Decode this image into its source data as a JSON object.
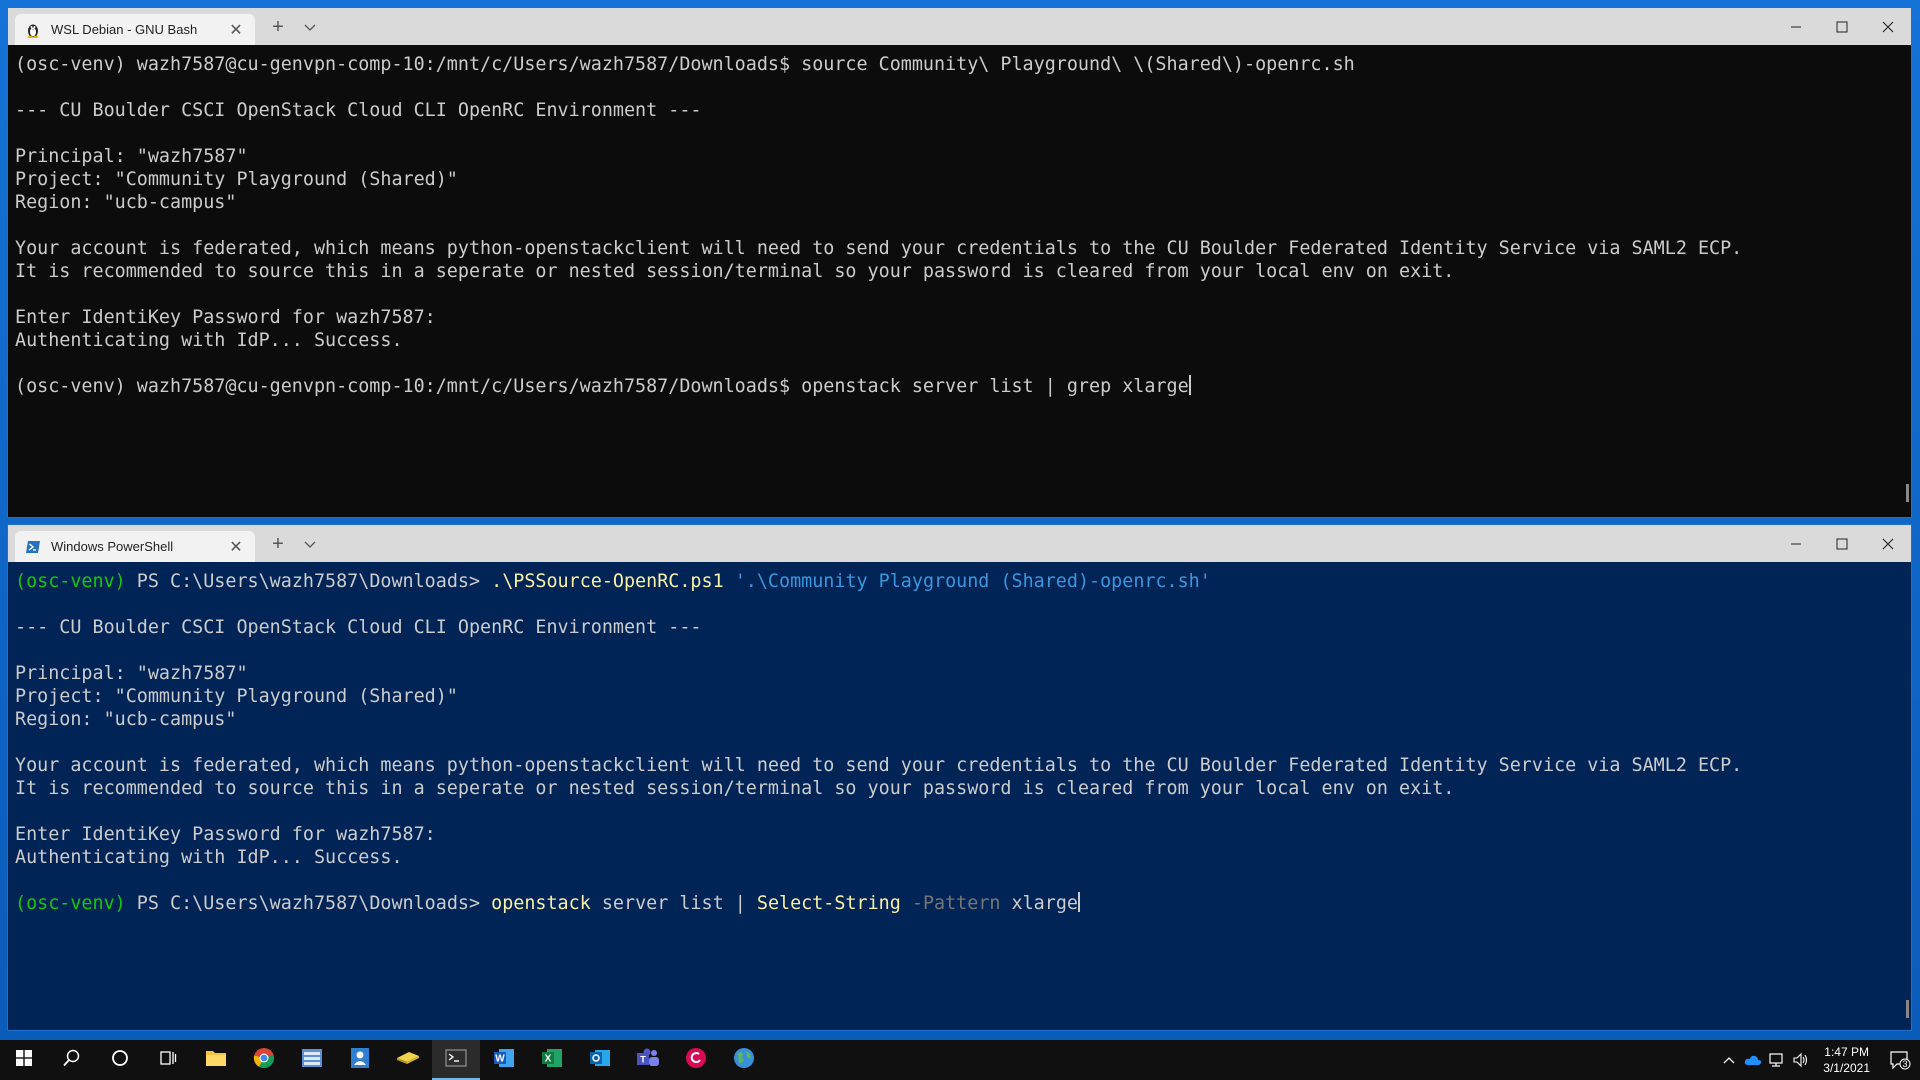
{
  "windows": [
    {
      "tab_title": "WSL Debian - GNU Bash",
      "tab_icon": "linux-penguin-icon",
      "lines": [
        [
          {
            "t": "(osc-venv) wazh7587@cu-genvpn-comp-10:/mnt/c/Users/wazh7587/Downloads$ source Community\\ Playground\\ \\(Shared\\)-openrc.sh"
          }
        ],
        [
          {
            "t": ""
          }
        ],
        [
          {
            "t": "--- CU Boulder CSCI OpenStack Cloud CLI OpenRC Environment ---"
          }
        ],
        [
          {
            "t": ""
          }
        ],
        [
          {
            "t": "Principal: \"wazh7587\""
          }
        ],
        [
          {
            "t": "Project: \"Community Playground (Shared)\""
          }
        ],
        [
          {
            "t": "Region: \"ucb-campus\""
          }
        ],
        [
          {
            "t": ""
          }
        ],
        [
          {
            "t": "Your account is federated, which means python-openstackclient will need to send your credentials to the CU Boulder Federated Identity Service via SAML2 ECP."
          }
        ],
        [
          {
            "t": "It is recommended to source this in a seperate or nested session/terminal so your password is cleared from your local env on exit."
          }
        ],
        [
          {
            "t": ""
          }
        ],
        [
          {
            "t": "Enter IdentiKey Password for wazh7587:"
          }
        ],
        [
          {
            "t": "Authenticating with IdP... Success."
          }
        ],
        [
          {
            "t": ""
          }
        ],
        [
          {
            "t": "(osc-venv) wazh7587@cu-genvpn-comp-10:/mnt/c/Users/wazh7587/Downloads$ openstack server list | grep xlarge",
            "cursor": true
          }
        ]
      ]
    },
    {
      "tab_title": "Windows PowerShell",
      "tab_icon": "powershell-icon",
      "lines": [
        [
          {
            "t": "(osc-venv)",
            "c": "prompt-venv"
          },
          {
            "t": " PS C:\\Users\\wazh7587\\Downloads> "
          },
          {
            "t": ".\\PSSource-OpenRC.ps1",
            "c": "ps-cmd"
          },
          {
            "t": " "
          },
          {
            "t": "'.\\Community Playground (Shared)-openrc.sh'",
            "c": "ps-str"
          }
        ],
        [
          {
            "t": ""
          }
        ],
        [
          {
            "t": "--- CU Boulder CSCI OpenStack Cloud CLI OpenRC Environment ---"
          }
        ],
        [
          {
            "t": ""
          }
        ],
        [
          {
            "t": "Principal: \"wazh7587\""
          }
        ],
        [
          {
            "t": "Project: \"Community Playground (Shared)\""
          }
        ],
        [
          {
            "t": "Region: \"ucb-campus\""
          }
        ],
        [
          {
            "t": ""
          }
        ],
        [
          {
            "t": "Your account is federated, which means python-openstackclient will need to send your credentials to the CU Boulder Federated Identity Service via SAML2 ECP."
          }
        ],
        [
          {
            "t": "It is recommended to source this in a seperate or nested session/terminal so your password is cleared from your local env on exit."
          }
        ],
        [
          {
            "t": ""
          }
        ],
        [
          {
            "t": "Enter IdentiKey Password for wazh7587:"
          }
        ],
        [
          {
            "t": "Authenticating with IdP... Success."
          }
        ],
        [
          {
            "t": ""
          }
        ],
        [
          {
            "t": "(osc-venv)",
            "c": "prompt-venv"
          },
          {
            "t": " PS C:\\Users\\wazh7587\\Downloads> "
          },
          {
            "t": "openstack",
            "c": "ps-cmd"
          },
          {
            "t": " server list | "
          },
          {
            "t": "Select-String",
            "c": "ps-cmd"
          },
          {
            "t": " "
          },
          {
            "t": "-Pattern",
            "c": "ps-param"
          },
          {
            "t": " xlarge",
            "cursor": true
          }
        ]
      ]
    }
  ],
  "taskbar": {
    "apps": [
      "start-icon",
      "search-icon",
      "cortana-icon",
      "task-view-icon",
      "file-explorer-icon",
      "chrome-icon",
      "file-manager-icon",
      "contacts-icon",
      "notes-icon",
      "terminal-icon",
      "word-icon",
      "excel-icon",
      "outlook-icon",
      "teams-icon",
      "debian-icon",
      "globe-icon"
    ],
    "active_app": "terminal-icon",
    "time": "1:47 PM",
    "date": "3/1/2021",
    "notification_count": "3"
  },
  "colors": {
    "bash_bg": "#0c0c0c",
    "powershell_bg": "#012456",
    "venv_green": "#16c60c",
    "ps_command_yellow": "#f9f1a5",
    "ps_string_blue": "#3a96dd",
    "ps_param_gray": "#767676"
  }
}
